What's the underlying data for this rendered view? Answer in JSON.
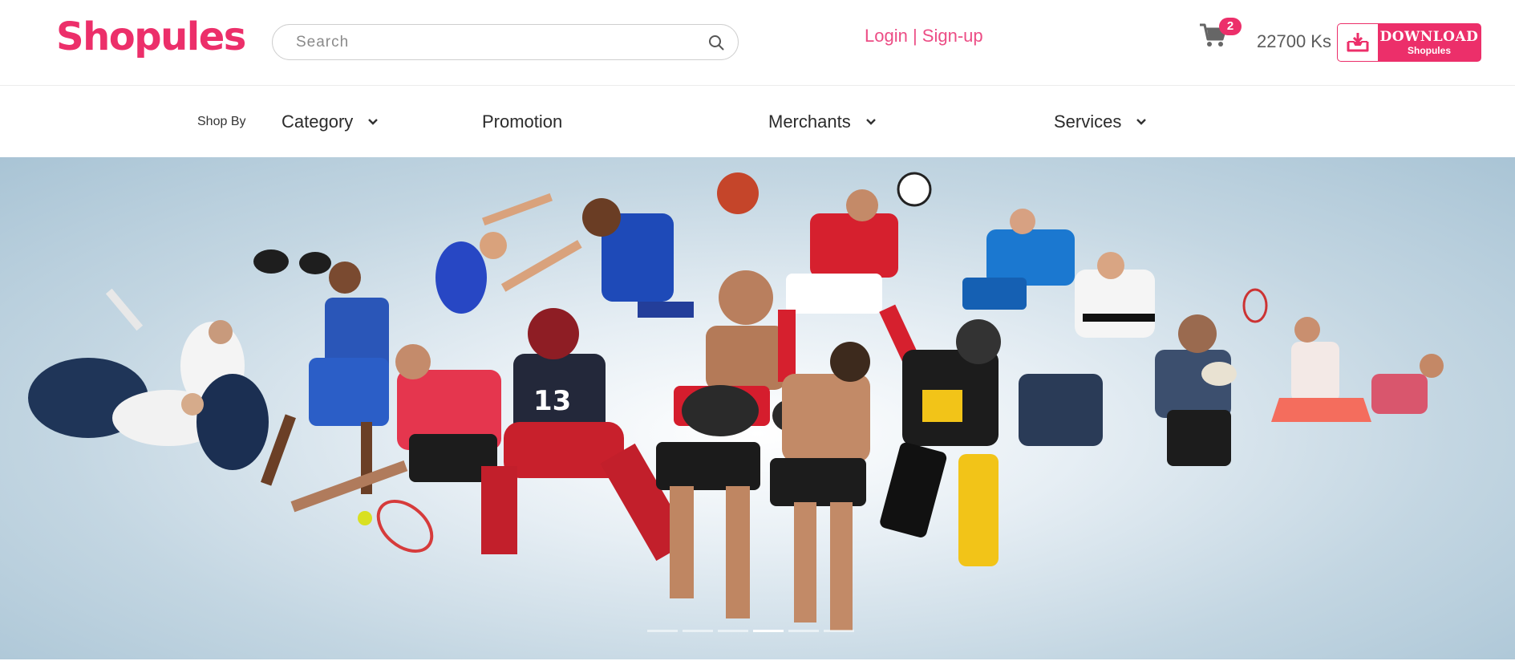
{
  "brand": {
    "name": "Shopules",
    "color": "#ec2f6a"
  },
  "search": {
    "placeholder": "Search",
    "value": ""
  },
  "auth": {
    "login": "Login",
    "separator": " | ",
    "signup": "Sign-up"
  },
  "cart": {
    "count": "2",
    "icon": "cart-icon"
  },
  "balance": "22700 Ks",
  "download": {
    "line1": "DOWNLOAD",
    "line2": "Shopules",
    "icon": "download-tray-icon"
  },
  "nav": {
    "shop_by": "Shop By",
    "items": [
      {
        "label": "Category",
        "has_dropdown": true
      },
      {
        "label": "Promotion",
        "has_dropdown": false
      },
      {
        "label": "Merchants",
        "has_dropdown": true
      },
      {
        "label": "Services",
        "has_dropdown": true
      }
    ]
  },
  "hero": {
    "image": "collage of athletes from many sports (judo, boxing, gymnastics, basketball, soccer, tennis, american football, hockey, karate, rugby, badminton)",
    "slides_total": 6,
    "active_slide": 4
  }
}
